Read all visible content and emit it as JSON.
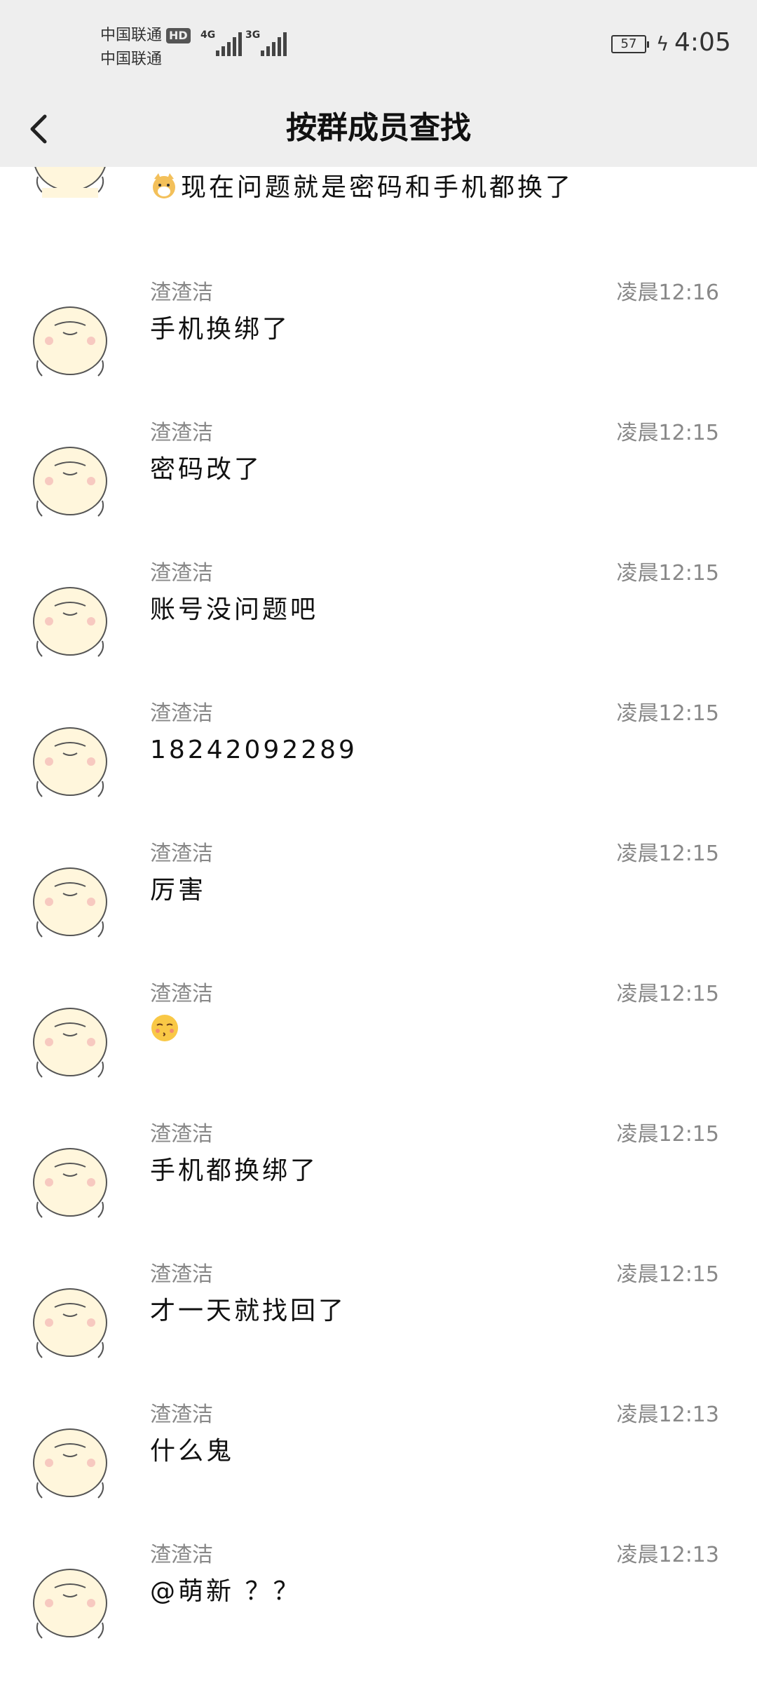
{
  "status_bar": {
    "carrier_1": "中国联通",
    "carrier_2": "中国联通",
    "hd_label": "HD",
    "network_1": "4G",
    "network_2": "3G",
    "battery_level": "57",
    "time": "4:05"
  },
  "header": {
    "title": "按群成员查找",
    "back_icon": "chevron-left-icon"
  },
  "messages": [
    {
      "sender": "",
      "time": "",
      "text": "现在问题就是密码和手机都换了",
      "emoji": "dog-emoji"
    },
    {
      "sender": "渣渣洁",
      "time": "凌晨12:16",
      "text": "手机换绑了"
    },
    {
      "sender": "渣渣洁",
      "time": "凌晨12:15",
      "text": "密码改了"
    },
    {
      "sender": "渣渣洁",
      "time": "凌晨12:15",
      "text": "账号没问题吧"
    },
    {
      "sender": "渣渣洁",
      "time": "凌晨12:15",
      "text": "18242092289"
    },
    {
      "sender": "渣渣洁",
      "time": "凌晨12:15",
      "text": "厉害"
    },
    {
      "sender": "渣渣洁",
      "time": "凌晨12:15",
      "text": "",
      "emoji": "kissing-face-emoji"
    },
    {
      "sender": "渣渣洁",
      "time": "凌晨12:15",
      "text": "手机都换绑了"
    },
    {
      "sender": "渣渣洁",
      "time": "凌晨12:15",
      "text": "才一天就找回了"
    },
    {
      "sender": "渣渣洁",
      "time": "凌晨12:13",
      "text": "什么鬼"
    },
    {
      "sender": "渣渣洁",
      "time": "凌晨12:13",
      "text": "@萌新 ？？"
    }
  ],
  "colors": {
    "bar_background": "#eeeeee",
    "meta_text": "#888888",
    "message_text": "#111111"
  }
}
